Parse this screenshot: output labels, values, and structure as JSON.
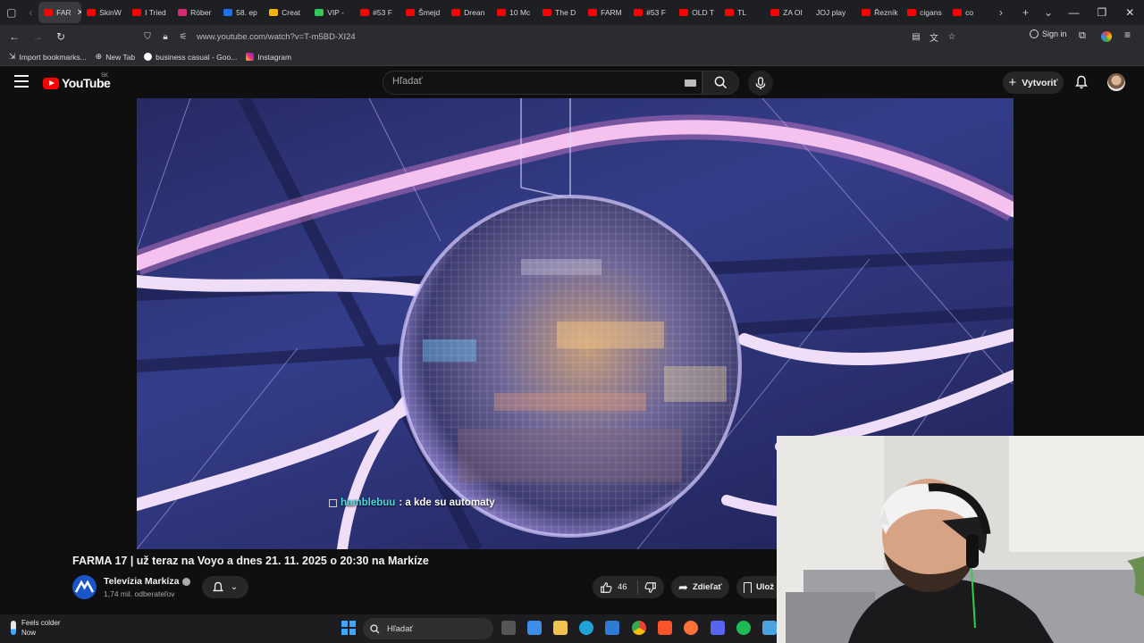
{
  "browser": {
    "tabs": [
      {
        "label": "FAR",
        "color": "#ff0000",
        "active": true
      },
      {
        "label": "SkinW",
        "color": "#ff0000"
      },
      {
        "label": "I Tried",
        "color": "#ff0000"
      },
      {
        "label": "Róber",
        "color": "#d62976"
      },
      {
        "label": "58. ep",
        "color": "#1a73e8"
      },
      {
        "label": "Creat",
        "color": "#f4b400"
      },
      {
        "label": "VIP -",
        "color": "#34c759"
      },
      {
        "label": "#53 F",
        "color": "#ff0000"
      },
      {
        "label": "Šmejd",
        "color": "#ff0000"
      },
      {
        "label": "Drean",
        "color": "#ff0000"
      },
      {
        "label": "10 Mc",
        "color": "#ff0000"
      },
      {
        "label": "The D",
        "color": "#ff0000"
      },
      {
        "label": "FARM",
        "color": "#ff0000"
      },
      {
        "label": "#53 F",
        "color": "#ff0000"
      },
      {
        "label": "OLD T",
        "color": "#ff0000"
      },
      {
        "label": "TL",
        "color": "#ff0000"
      },
      {
        "label": "ZA OI",
        "color": "#ff0000"
      },
      {
        "label": "JOJ play",
        "color": ""
      },
      {
        "label": "Řezník",
        "color": "#ff0000"
      },
      {
        "label": "cigans",
        "color": "#ff0000"
      },
      {
        "label": "co",
        "color": "#ff0000"
      }
    ],
    "url": "www.youtube.com/watch?v=T-m5BD-XI24",
    "sign_in": "Sign in",
    "bookmarks": [
      {
        "label": "Import bookmarks...",
        "icon": "import-icon"
      },
      {
        "label": "New Tab",
        "icon": "globe-icon"
      },
      {
        "label": "business casual - Goo...",
        "icon": "google-icon"
      },
      {
        "label": "Instagram",
        "icon": "instagram-icon"
      }
    ]
  },
  "youtube": {
    "logo_text": "YouTube",
    "region": "SK",
    "search_placeholder": "Hľadať",
    "create_label": "Vytvoriť",
    "video": {
      "chat_user": "hamblebuu",
      "chat_message": ": a kde su automaty",
      "title": "FARMA 17 | už teraz na Voyo a dnes 21. 11. 2025 o 20:30 na Markíze"
    },
    "channel": {
      "name": "Televízia Markíza",
      "subscribers": "1,74 mil. odberateľov"
    },
    "actions": {
      "likes": "46",
      "share": "Zdieľať",
      "save": "Ulož"
    }
  },
  "taskbar": {
    "weather_line1": "Feels colder",
    "weather_line2": "Now",
    "search_placeholder": "Hľadať"
  },
  "colors": {
    "yt_red": "#ff0000",
    "page_bg": "#0f0f0f",
    "chat_user": "#4ed7d7"
  }
}
